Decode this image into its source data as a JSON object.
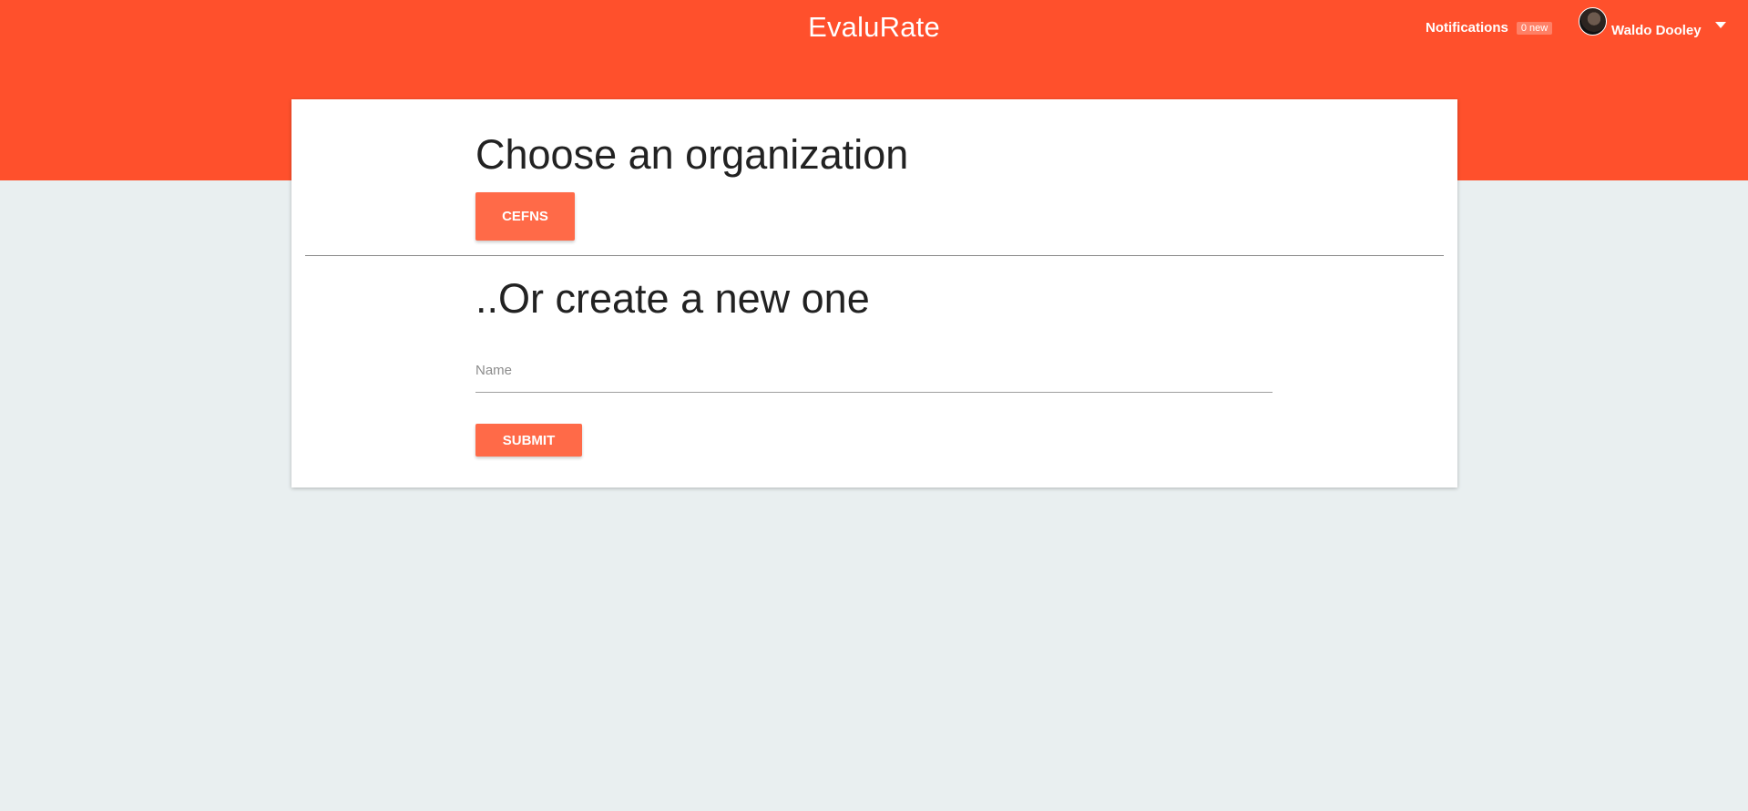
{
  "header": {
    "brand": "EvaluRate",
    "notifications_label": "Notifications",
    "notifications_badge": "0 new",
    "user_name": "Waldo Dooley",
    "accent_color": "#ff502c"
  },
  "choose": {
    "title": "Choose an organization",
    "organizations": [
      "CEFNS"
    ]
  },
  "create": {
    "title": "..Or create a new one",
    "name_placeholder": "Name",
    "name_value": "",
    "submit_label": "SUBMIT"
  }
}
